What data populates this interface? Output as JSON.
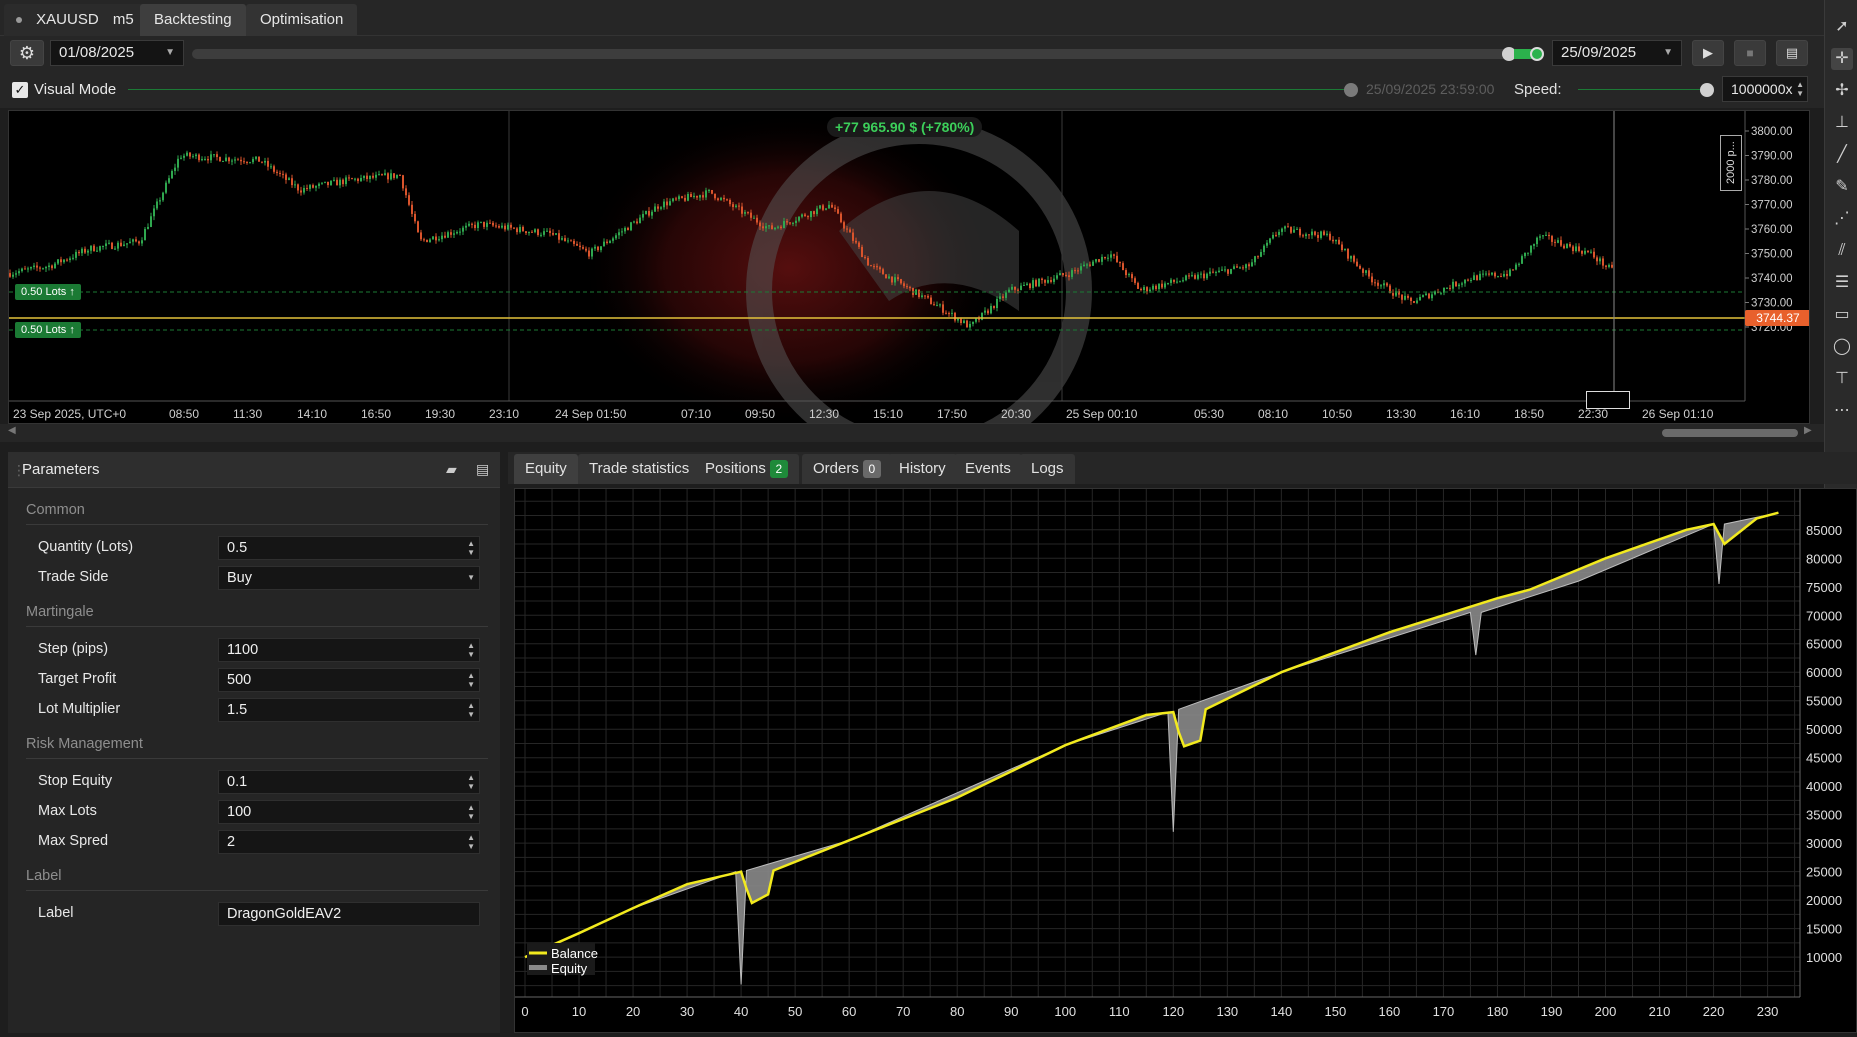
{
  "header": {
    "symbol": "XAUUSD",
    "timeframe": "m5",
    "tabs": [
      "Backtesting",
      "Optimisation"
    ],
    "active_tab": "Backtesting"
  },
  "controls": {
    "start_date": "01/08/2025",
    "end_date": "25/09/2025",
    "visual_mode_label": "Visual Mode",
    "visual_mode_checked": true,
    "current_time": "25/09/2025 23:59:00",
    "speed_label": "Speed:",
    "speed_value": "1000000x"
  },
  "price_chart": {
    "profit_label": "+77 965.90 $ (+780%)",
    "current_price": "3744.37",
    "zoom_label": "2000 p...",
    "y_ticks": [
      "3800.00",
      "3790.00",
      "3780.00",
      "3770.00",
      "3760.00",
      "3750.00",
      "3740.00",
      "3730.00",
      "3720.00"
    ],
    "x_ticks": [
      "23 Sep 2025, UTC+0",
      "08:50",
      "11:30",
      "14:10",
      "16:50",
      "19:30",
      "23:10",
      "24 Sep 01:50",
      "07:10",
      "09:50",
      "12:30",
      "15:10",
      "17:50",
      "20:30",
      "25 Sep 00:10",
      "05:30",
      "08:10",
      "10:50",
      "13:30",
      "16:10",
      "18:50",
      "22:30",
      "26 Sep 01:10"
    ],
    "position_labels": [
      "0.50 Lots",
      "0.50 Lots"
    ],
    "colors": {
      "up": "#2fa84f",
      "down": "#d9542c",
      "price_line": "#e2c23a",
      "price_badge": "#e8602c"
    }
  },
  "parameters": {
    "title": "Parameters",
    "groups": [
      {
        "name": "Common",
        "items": [
          {
            "label": "Quantity (Lots)",
            "value": "0.5",
            "kind": "spin"
          },
          {
            "label": "Trade Side",
            "value": "Buy",
            "kind": "select"
          }
        ]
      },
      {
        "name": "Martingale",
        "items": [
          {
            "label": "Step (pips)",
            "value": "1100",
            "kind": "spin"
          },
          {
            "label": "Target Profit",
            "value": "500",
            "kind": "spin"
          },
          {
            "label": "Lot Multiplier",
            "value": "1.5",
            "kind": "spin"
          }
        ]
      },
      {
        "name": "Risk Management",
        "items": [
          {
            "label": "Stop Equity",
            "value": "0.1",
            "kind": "spin"
          },
          {
            "label": "Max Lots",
            "value": "100",
            "kind": "spin"
          },
          {
            "label": "Max Spred",
            "value": "2",
            "kind": "spin"
          }
        ]
      },
      {
        "name": "Label",
        "items": [
          {
            "label": "Label",
            "value": "DragonGoldEAV2",
            "kind": "text"
          }
        ]
      }
    ]
  },
  "bottom_tabs": [
    {
      "label": "Equity",
      "active": true
    },
    {
      "label": "Trade statistics"
    },
    {
      "label": "Positions",
      "badge": "2",
      "badge_color": "#1f8a3a"
    },
    {
      "label": "Orders",
      "badge": "0",
      "badge_color": "#6a6a6a"
    },
    {
      "label": "History"
    },
    {
      "label": "Events"
    },
    {
      "label": "Logs"
    }
  ],
  "chart_data": {
    "type": "line",
    "x_ticks": [
      0,
      10,
      20,
      30,
      40,
      50,
      60,
      70,
      80,
      90,
      100,
      110,
      120,
      130,
      140,
      150,
      160,
      170,
      180,
      190,
      200,
      210,
      220,
      230
    ],
    "y_ticks": [
      10000,
      15000,
      20000,
      25000,
      30000,
      35000,
      40000,
      45000,
      50000,
      55000,
      60000,
      65000,
      70000,
      75000,
      80000,
      85000
    ],
    "xlim": [
      0,
      236
    ],
    "ylim": [
      3000,
      89000
    ],
    "legend": [
      "Balance",
      "Equity"
    ],
    "legend_position": "bottom-left",
    "series": [
      {
        "name": "Balance",
        "color": "#f2ea1e",
        "x": [
          0,
          10,
          20,
          30,
          40,
          41,
          42,
          45,
          46,
          60,
          80,
          100,
          115,
          120,
          121,
          122,
          125,
          126,
          140,
          160,
          180,
          186,
          200,
          215,
          220,
          222,
          228,
          232
        ],
        "values": [
          10000,
          14200,
          18600,
          22800,
          25000,
          22000,
          19500,
          21000,
          25200,
          30500,
          38000,
          47200,
          52500,
          53000,
          49500,
          47000,
          48000,
          53500,
          60000,
          67000,
          73000,
          74500,
          80000,
          85000,
          86000,
          82500,
          87000,
          88000
        ]
      },
      {
        "name": "Equity",
        "color": "#9a9a9a",
        "x": [
          0,
          20,
          39,
          40,
          41,
          60,
          100,
          119,
          120,
          121,
          140,
          175,
          176,
          177,
          195,
          220,
          221,
          222,
          232
        ],
        "values": [
          10000,
          18600,
          25000,
          5200,
          25200,
          30500,
          47200,
          53000,
          32000,
          53500,
          60000,
          70500,
          63000,
          70500,
          76000,
          86000,
          75500,
          86000,
          88000
        ]
      }
    ],
    "grid": true
  }
}
